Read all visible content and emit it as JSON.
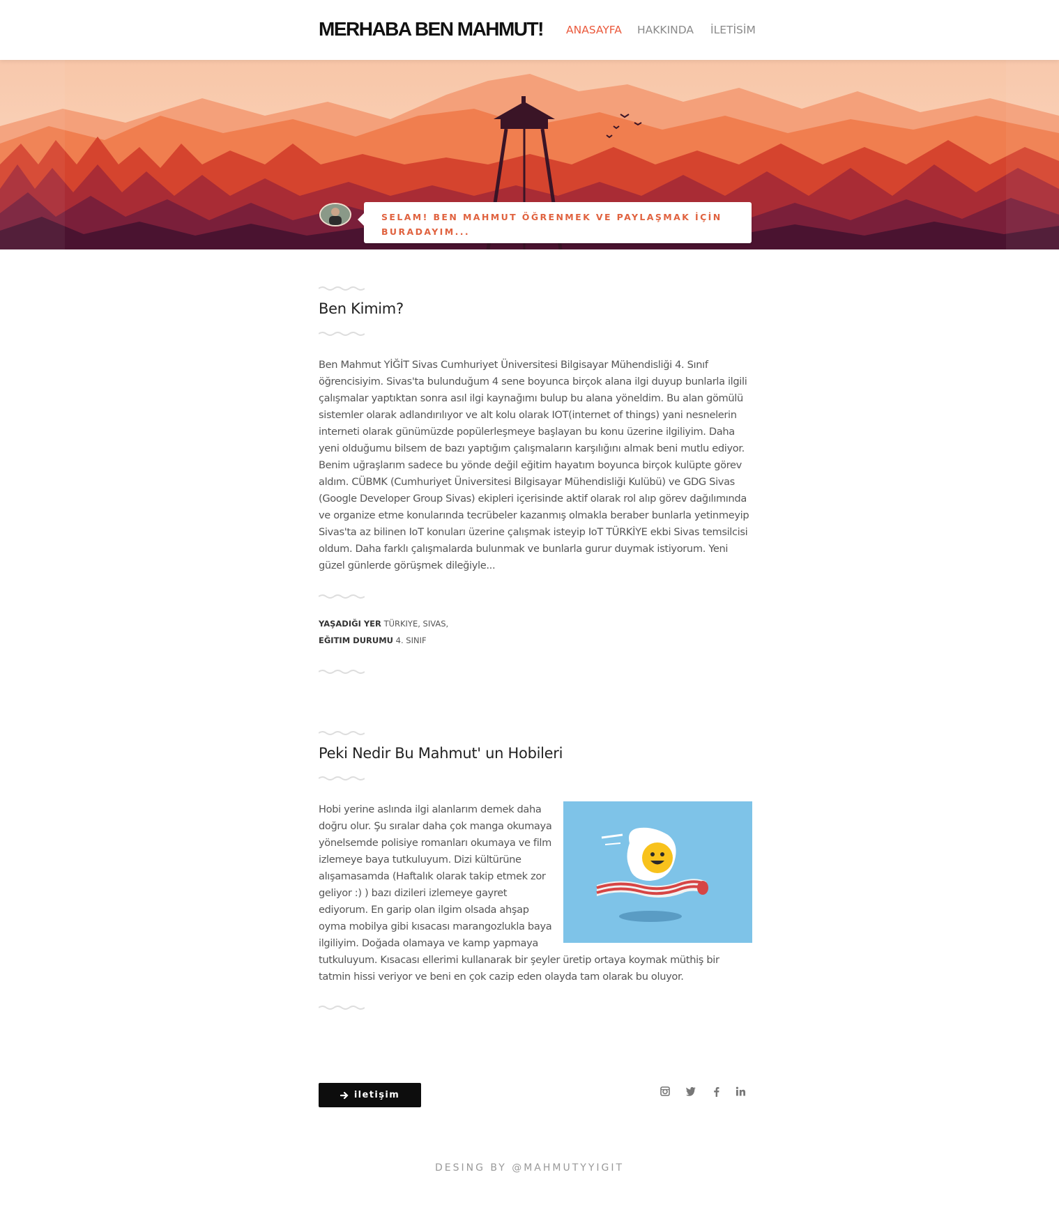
{
  "header": {
    "logo": "MERHABA BEN MAHMUT!",
    "nav": [
      {
        "label": "ANASAYFA",
        "active": true
      },
      {
        "label": "HAKKINDA",
        "active": false
      },
      {
        "label": "İLETİSİM",
        "active": false
      }
    ]
  },
  "hero": {
    "greeting": "SELAM! BEN MAHMUT ÖĞRENMEK VE PAYLAŞMAK İÇİN BURADAYIM...",
    "avatar_icon": "profile-photo"
  },
  "about": {
    "title": "Ben Kimim?",
    "paragraph": "Ben Mahmut YİĞİT Sivas Cumhuriyet Üniversitesi Bilgisayar Mühendisliği 4. Sınıf öğrencisiyim. Sivas'ta bulunduğum 4 sene boyunca birçok alana ilgi duyup bunlarla ilgili çalışmalar yaptıktan sonra asıl ilgi kaynağımı bulup bu alana yöneldim. Bu alan gömülü sistemler olarak adlandırılıyor ve alt kolu olarak IOT(internet of things) yani nesnelerin interneti olarak günümüzde popülerleşmeye başlayan bu konu üzerine ilgiliyim. Daha yeni olduğumu bilsem de bazı yaptığım çalışmaların karşılığını almak beni mutlu ediyor. Benim uğraşlarım sadece bu yönde değil eğitim hayatım boyunca birçok kulüpte görev aldım. CÜBMK (Cumhuriyet Üniversitesi Bilgisayar Mühendisliği Kulübü) ve GDG Sivas (Google Developer Group Sivas) ekipleri içerisinde aktif olarak rol alıp görev dağılımında ve organize etme konularında tecrübeler kazanmış olmakla beraber bunlarla yetinmeyip Sivas'ta az bilinen IoT konuları üzerine çalışmak isteyip IoT TÜRKİYE ekbi Sivas temsilcisi oldum. Daha farklı çalışmalarda bulunmak ve bunlarla gurur duymak istiyorum. Yeni güzel günlerde görüşmek dileğiyle...",
    "meta": [
      {
        "label": "YAŞADIĞI YER",
        "value": "TÜRKIYE, SIVAS,"
      },
      {
        "label": "EĞITIM DURUMU",
        "value": "4. SINIF"
      }
    ]
  },
  "hobbies": {
    "title": "Peki Nedir Bu Mahmut' un Hobileri",
    "paragraph": "Hobi yerine aslında ilgi alanlarım demek daha doğru olur. Şu sıralar daha çok manga okumaya yönelsemde polisiye romanları okumaya ve film izlemeye baya tutkuluyum. Dizi kültürüne alışamasamda (Haftalık olarak takip etmek zor geliyor :) ) bazı dizileri izlemeye gayret ediyorum. En garip olan ilgim olsada ahşap oyma mobilya gibi kısacası marangozlukla baya ilgiliyim. Doğada olamaya ve kamp yapmaya tutkuluyum. Kısacası ellerimi kullanarak bir şeyler üretip ortaya koymak müthiş bir tatmin hissi veriyor ve beni en çok cazip eden olayda tam olarak bu oluyor.",
    "image_icon": "egg-on-bacon-illustration"
  },
  "footer": {
    "contact_button": "iletişim",
    "social_icons": [
      "instagram-icon",
      "twitter-icon",
      "facebook-icon",
      "linkedin-icon"
    ],
    "credit": "DESING BY @MAHMUTYYIGIT"
  },
  "colors": {
    "accent": "#ea5a3d",
    "bubble_text": "#e0623f",
    "button": "#0d0d0d",
    "image_bg": "#7ec3e8"
  }
}
